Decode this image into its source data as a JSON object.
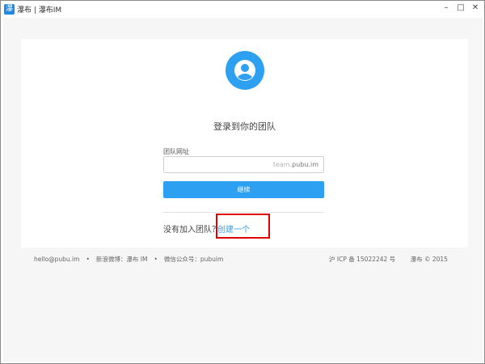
{
  "window": {
    "app_icon": "瀑",
    "title": "瀑布 | 瀑布IM",
    "minimize": "–",
    "maximize": "□",
    "close": "✕"
  },
  "login": {
    "heading": "登录到你的团队",
    "field_label": "团队网址",
    "domain_value": "",
    "domain_placeholder": "team",
    "domain_suffix": ".pubu.im",
    "submit_label": "继续",
    "no_team_text": "没有加入团队？",
    "create_link": "创建一个"
  },
  "footer": {
    "email": "hello@pubu.im",
    "sep": "•",
    "weibo": "新浪微博：瀑布 IM",
    "wechat": "微信公众号：pubuim",
    "icp": "沪 ICP 备 15022242 号",
    "copyright": "瀑布 © 2015"
  },
  "colors": {
    "accent": "#2ea0f2",
    "highlight": "#e00000"
  }
}
